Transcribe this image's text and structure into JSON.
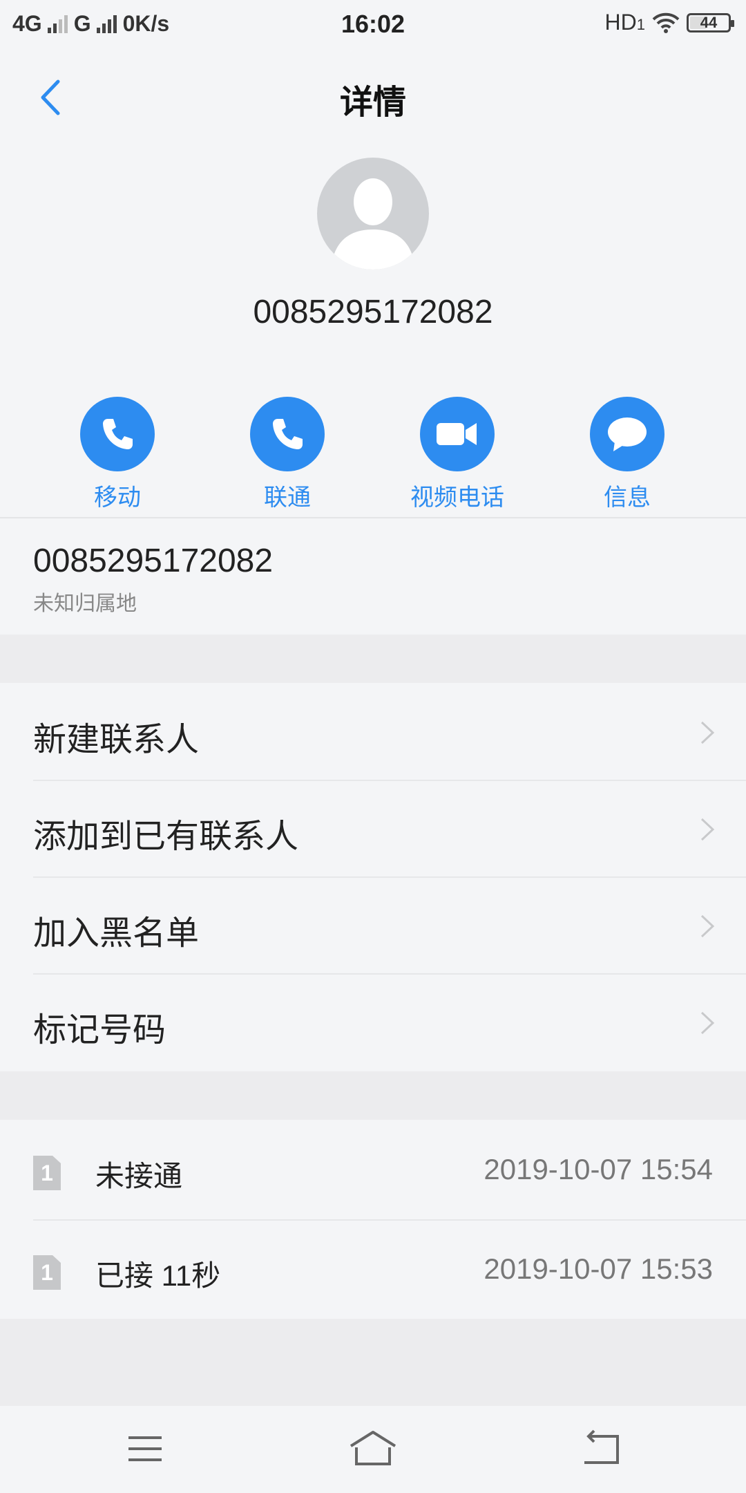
{
  "status_bar": {
    "network_left": "4G",
    "network_g": "G",
    "speed": "0K/s",
    "time": "16:02",
    "hd": "HD",
    "hd_sub": "1",
    "battery": "44"
  },
  "header": {
    "title": "详情"
  },
  "contact": {
    "number": "0085295172082",
    "location": "未知归属地"
  },
  "actions": [
    {
      "label": "移动",
      "icon": "phone-icon"
    },
    {
      "label": "联通",
      "icon": "phone-icon"
    },
    {
      "label": "视频电话",
      "icon": "video-camera-icon"
    },
    {
      "label": "信息",
      "icon": "message-bubble-icon"
    }
  ],
  "menu": [
    {
      "label": "新建联系人"
    },
    {
      "label": "添加到已有联系人"
    },
    {
      "label": "加入黑名单"
    },
    {
      "label": "标记号码"
    }
  ],
  "call_log": [
    {
      "sim": "1",
      "status": "未接通",
      "time": "2019-10-07 15:54"
    },
    {
      "sim": "1",
      "status": "已接 11秒",
      "time": "2019-10-07 15:53"
    }
  ],
  "colors": {
    "accent": "#2d8cf0",
    "background": "#f4f5f7"
  }
}
